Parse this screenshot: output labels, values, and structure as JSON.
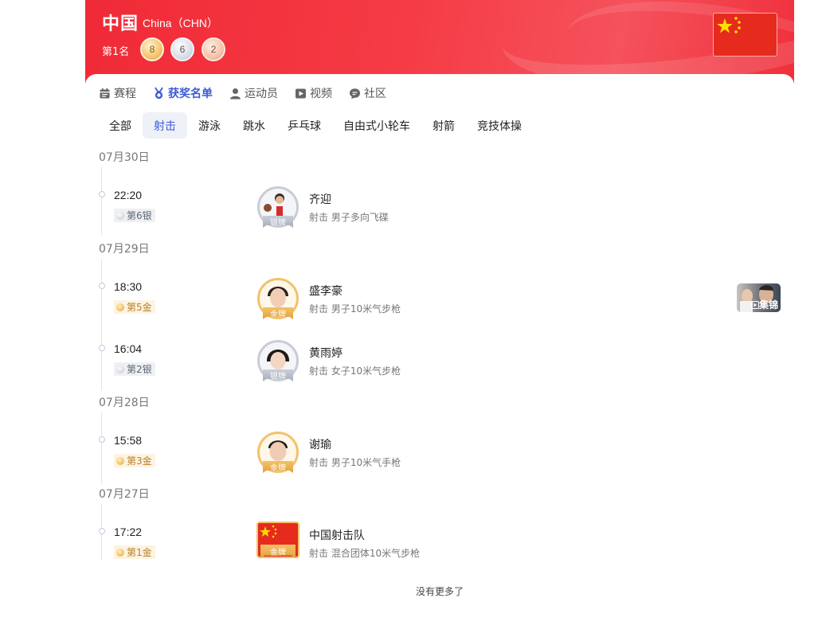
{
  "header": {
    "country_name": "中国",
    "country_en": "China（CHN）",
    "rank": "第1名",
    "medals": {
      "gold": "8",
      "silver": "6",
      "bronze": "2"
    },
    "accent": "#f02a36"
  },
  "nav": [
    {
      "label": "赛程",
      "icon": "calendar-icon",
      "active": false
    },
    {
      "label": "获奖名单",
      "icon": "medal-icon",
      "active": true
    },
    {
      "label": "运动员",
      "icon": "person-icon",
      "active": false
    },
    {
      "label": "视频",
      "icon": "play-icon",
      "active": false
    },
    {
      "label": "社区",
      "icon": "chat-icon",
      "active": false
    }
  ],
  "filters": [
    "全部",
    "射击",
    "游泳",
    "跳水",
    "乒乓球",
    "自由式小轮车",
    "射箭",
    "竞技体操"
  ],
  "active_filter": "射击",
  "dates": [
    "07月30日",
    "07月29日",
    "07月28日",
    "07月27日"
  ],
  "entries": [
    {
      "time": "22:20",
      "badge": "第6银",
      "medal": "silver",
      "ribbon": "银牌",
      "name": "齐迎",
      "event": "射击 男子多向飞碟"
    },
    {
      "time": "18:30",
      "badge": "第5金",
      "medal": "gold",
      "ribbon": "金牌",
      "name": "盛李豪",
      "event": "射击 男子10米气步枪",
      "highlight": "集锦"
    },
    {
      "time": "16:04",
      "badge": "第2银",
      "medal": "silver",
      "ribbon": "银牌",
      "name": "黄雨婷",
      "event": "射击 女子10米气步枪"
    },
    {
      "time": "15:58",
      "badge": "第3金",
      "medal": "gold",
      "ribbon": "金牌",
      "name": "谢瑜",
      "event": "射击 男子10米气手枪"
    },
    {
      "time": "17:22",
      "badge": "第1金",
      "medal": "gold",
      "ribbon": "金牌",
      "name": "中国射击队",
      "event": "射击 混合团体10米气步枪"
    }
  ],
  "footer": {
    "no_more": "没有更多了"
  }
}
